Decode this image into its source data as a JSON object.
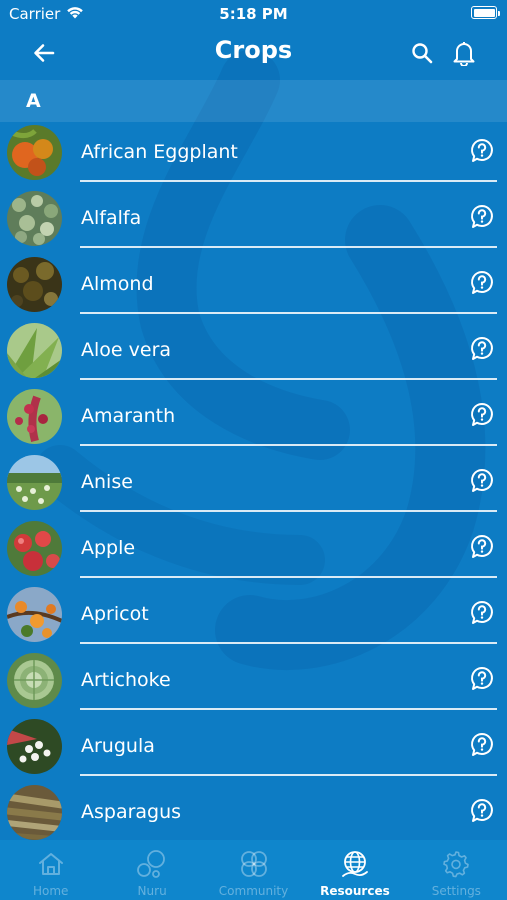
{
  "status_bar": {
    "carrier": "Carrier",
    "time": "5:18 PM"
  },
  "nav": {
    "title": "Crops",
    "back_icon": "arrow-left-icon",
    "search_icon": "search-icon",
    "bell_icon": "bell-icon"
  },
  "section": {
    "letter": "A"
  },
  "crops": [
    {
      "name": "African Eggplant",
      "thumb": "african-eggplant-photo"
    },
    {
      "name": "Alfalfa",
      "thumb": "alfalfa-photo"
    },
    {
      "name": "Almond",
      "thumb": "almond-photo"
    },
    {
      "name": "Aloe vera",
      "thumb": "aloe-vera-photo"
    },
    {
      "name": "Amaranth",
      "thumb": "amaranth-photo"
    },
    {
      "name": "Anise",
      "thumb": "anise-photo"
    },
    {
      "name": "Apple",
      "thumb": "apple-photo"
    },
    {
      "name": "Apricot",
      "thumb": "apricot-photo"
    },
    {
      "name": "Artichoke",
      "thumb": "artichoke-photo"
    },
    {
      "name": "Arugula",
      "thumb": "arugula-photo"
    },
    {
      "name": "Asparagus",
      "thumb": "asparagus-photo"
    }
  ],
  "tabs": [
    {
      "label": "Home",
      "icon": "home-icon",
      "active": false
    },
    {
      "label": "Nuru",
      "icon": "nuru-bubbles-icon",
      "active": false
    },
    {
      "label": "Community",
      "icon": "community-icon",
      "active": false
    },
    {
      "label": "Resources",
      "icon": "globe-icon",
      "active": true
    },
    {
      "label": "Settings",
      "icon": "gear-icon",
      "active": false
    }
  ],
  "colors": {
    "background": "#0d7cc4",
    "tab_bar": "#0f86cc",
    "text": "#ffffff",
    "inactive_tab": "rgba(255,255,255,0.35)"
  }
}
